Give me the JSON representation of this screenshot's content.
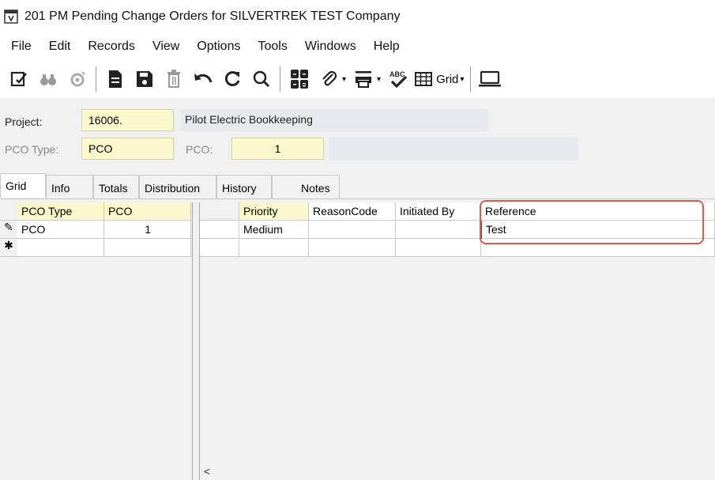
{
  "window": {
    "title": "201 PM Pending Change Orders for SILVERTREK TEST Company",
    "icon": "app-window-icon"
  },
  "menu": [
    "File",
    "Edit",
    "Records",
    "View",
    "Options",
    "Tools",
    "Windows",
    "Help"
  ],
  "toolbar": {
    "grid_label": "Grid"
  },
  "form": {
    "project_label": "Project:",
    "project_value": "16006.",
    "project_description": "Pilot Electric Bookkeeping",
    "pco_type_label": "PCO Type:",
    "pco_type_value": "PCO",
    "pco_label": "PCO:",
    "pco_value": "1",
    "pco_description": ""
  },
  "tabs": [
    "Grid",
    "Info",
    "Totals",
    "Distribution",
    "History",
    "Notes"
  ],
  "left_grid": {
    "columns": [
      "PCO Type",
      "PCO"
    ],
    "rows": [
      {
        "indicator": "✎",
        "pco_type": "PCO",
        "pco": "1"
      },
      {
        "indicator": "✱",
        "pco_type": "",
        "pco": ""
      }
    ]
  },
  "right_grid": {
    "columns": [
      "",
      "Priority",
      "ReasonCode",
      "Initiated By",
      "Reference"
    ],
    "rows": [
      {
        "blank": "",
        "priority": "Medium",
        "reason_code": "",
        "initiated_by": "",
        "reference": "Test"
      },
      {
        "blank": "",
        "priority": "",
        "reason_code": "",
        "initiated_by": "",
        "reference": ""
      }
    ]
  },
  "colors": {
    "key_field": "#fbf8cc",
    "highlight": "#d85a4a"
  }
}
